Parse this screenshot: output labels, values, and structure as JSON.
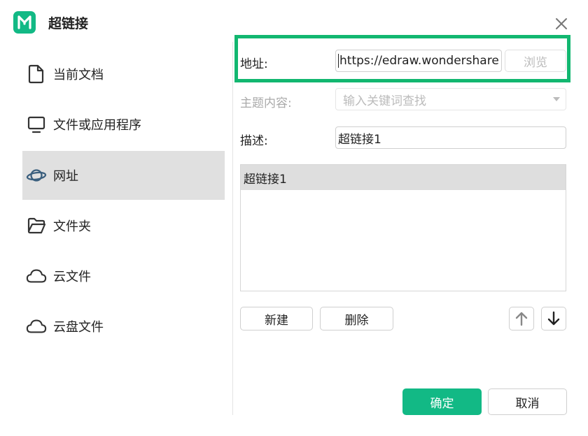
{
  "dialog": {
    "title": "超链接",
    "close_icon": "close-icon",
    "accent": "#12b985"
  },
  "sidebar": {
    "items": [
      {
        "label": "当前文档",
        "icon": "document-icon",
        "active": false
      },
      {
        "label": "文件或应用程序",
        "icon": "monitor-icon",
        "active": false
      },
      {
        "label": "网址",
        "icon": "planet-icon",
        "active": true
      },
      {
        "label": "文件夹",
        "icon": "folder-icon",
        "active": false
      },
      {
        "label": "云文件",
        "icon": "cloud-icon",
        "active": false
      },
      {
        "label": "云盘文件",
        "icon": "cloud-icon",
        "active": false
      }
    ]
  },
  "form": {
    "address_label": "地址:",
    "address_value": "https://edraw.wondershare",
    "browse_label": "浏览",
    "topic_label": "主题内容:",
    "topic_placeholder": "输入关键词查找",
    "description_label": "描述:",
    "description_value": "超链接1"
  },
  "list": {
    "rows": [
      "超链接1"
    ]
  },
  "list_actions": {
    "new_label": "新建",
    "delete_label": "删除"
  },
  "footer": {
    "ok_label": "确定",
    "cancel_label": "取消"
  }
}
